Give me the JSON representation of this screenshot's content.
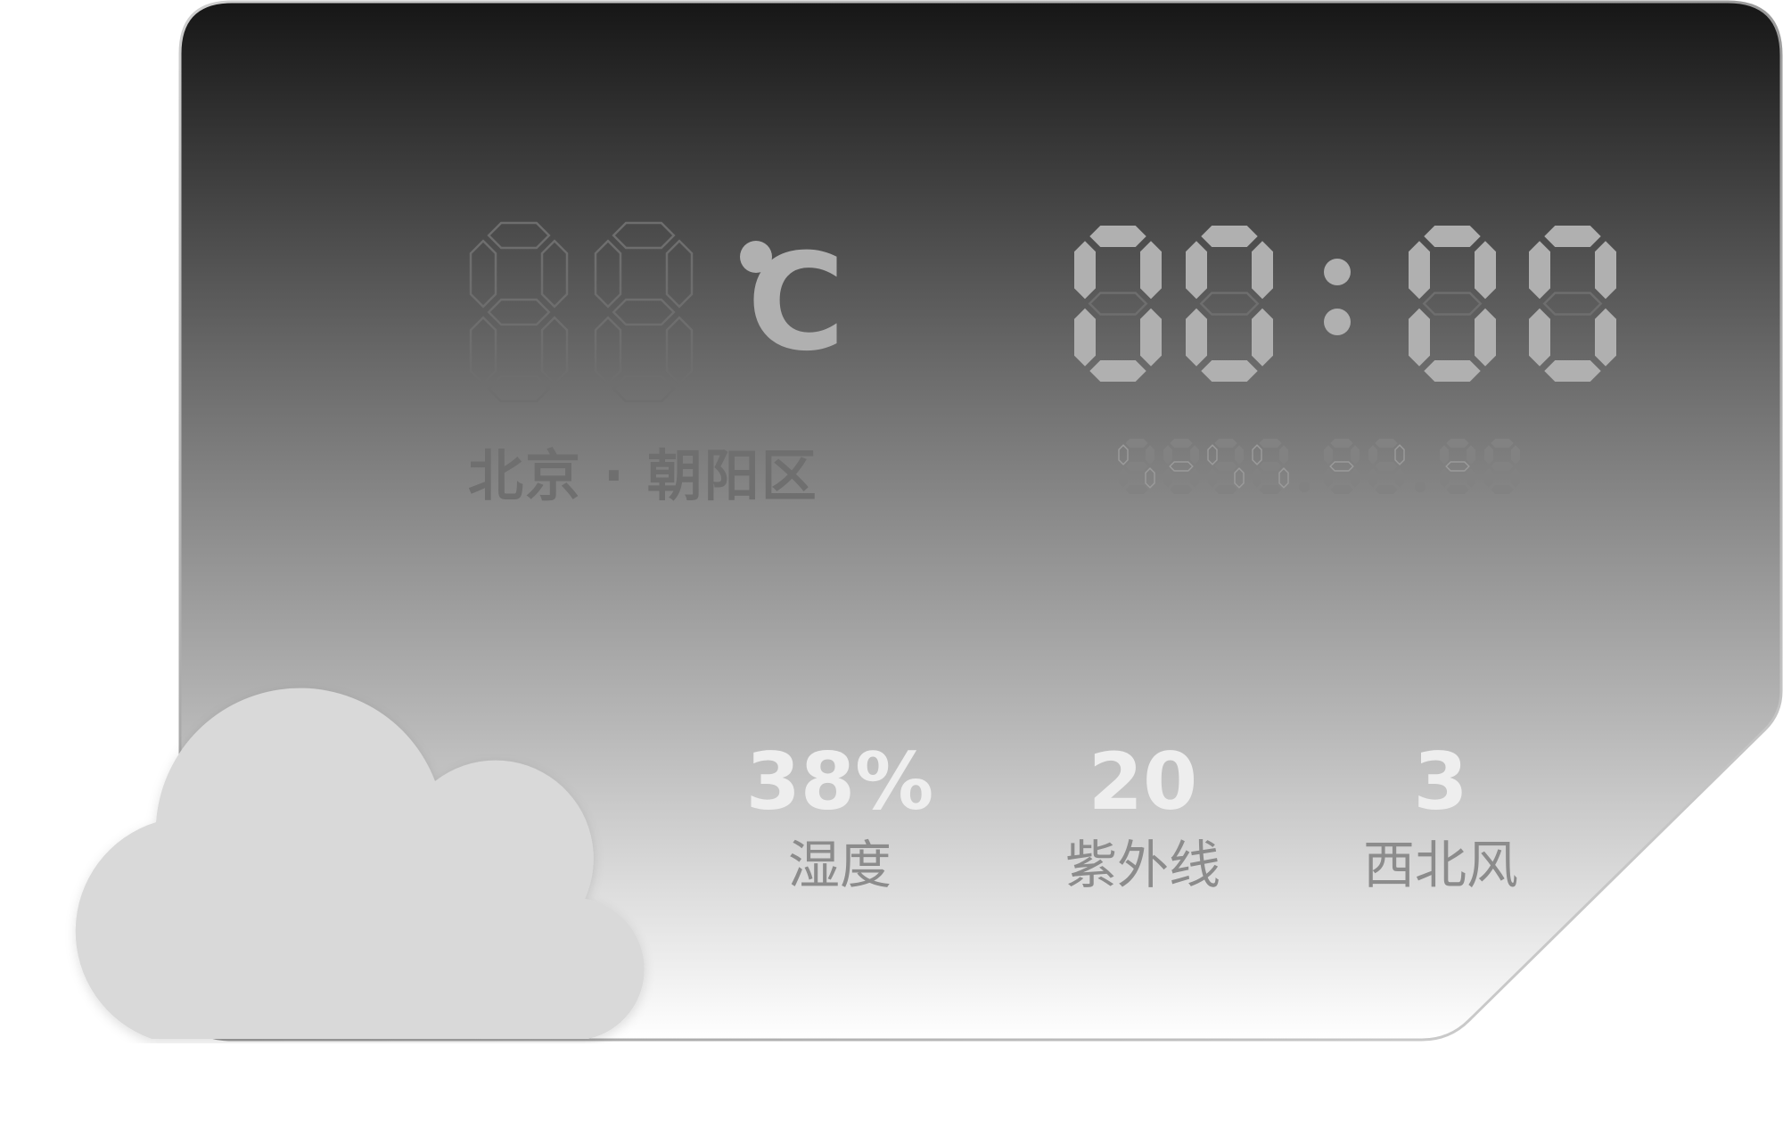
{
  "temperature": {
    "value": "",
    "unit": "C"
  },
  "location": {
    "city": "北京",
    "separator": "·",
    "district": "朝阳区",
    "full": "北京 · 朝阳区"
  },
  "clock": {
    "time": "00:00",
    "date": "2022.06.08"
  },
  "stats": [
    {
      "value": "38%",
      "label": "湿度"
    },
    {
      "value": "20",
      "label": "紫外线"
    },
    {
      "value": "3",
      "label": "西北风"
    }
  ],
  "icons": {
    "weather": "cloud-icon"
  },
  "colors": {
    "card_top": "#161616",
    "card_bottom": "#ffffff",
    "segment_on": "#b0b0b0",
    "segment_off": "#6e6e6e",
    "cloud": "#d9d9d9"
  }
}
